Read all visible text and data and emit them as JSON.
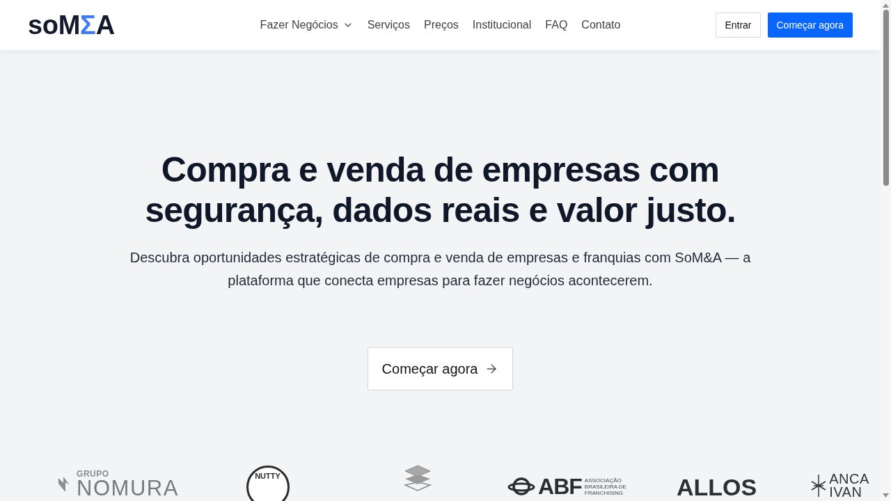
{
  "header": {
    "logo": [
      {
        "text": "soM",
        "color": "#131a2c"
      },
      {
        "text": "Σ",
        "color": "#3d7cf5"
      },
      {
        "text": "A",
        "color": "#131a2c"
      }
    ],
    "nav": [
      {
        "label": "Fazer Negócios",
        "kind": "dropdown"
      },
      {
        "label": "Serviços",
        "kind": "link"
      },
      {
        "label": "Preços",
        "kind": "link"
      },
      {
        "label": "Institucional",
        "kind": "link"
      },
      {
        "label": "FAQ",
        "kind": "link"
      },
      {
        "label": "Contato",
        "kind": "link"
      }
    ],
    "buttons": [
      {
        "label": "Entrar",
        "kind": "outline"
      },
      {
        "label": "Começar agora",
        "kind": "primary"
      }
    ]
  },
  "hero": {
    "title": "Compra e venda de empresas com segurança, dados reais e valor justo.",
    "subtitle": "Descubra oportunidades estratégicas de compra e venda de empresas e franquias com SoM&A — a plataforma que conecta empresas para fazer negócios acontecerem.",
    "cta": {
      "label": "Começar agora"
    }
  },
  "partners": [
    {
      "kind": "nomura",
      "caption": "GRUPO",
      "name": "NOMURA"
    },
    {
      "kind": "seal",
      "name": "NUTTY"
    },
    {
      "kind": "layers"
    },
    {
      "kind": "abf",
      "name": "ABF",
      "caption": [
        "ASSOCIAÇÃO",
        "BRASILEIRA DE",
        "FRANCHISING"
      ]
    },
    {
      "kind": "wordmark",
      "name": "ALLOS"
    },
    {
      "kind": "burst",
      "lines": [
        "ANCA",
        "IVAN"
      ]
    }
  ]
}
